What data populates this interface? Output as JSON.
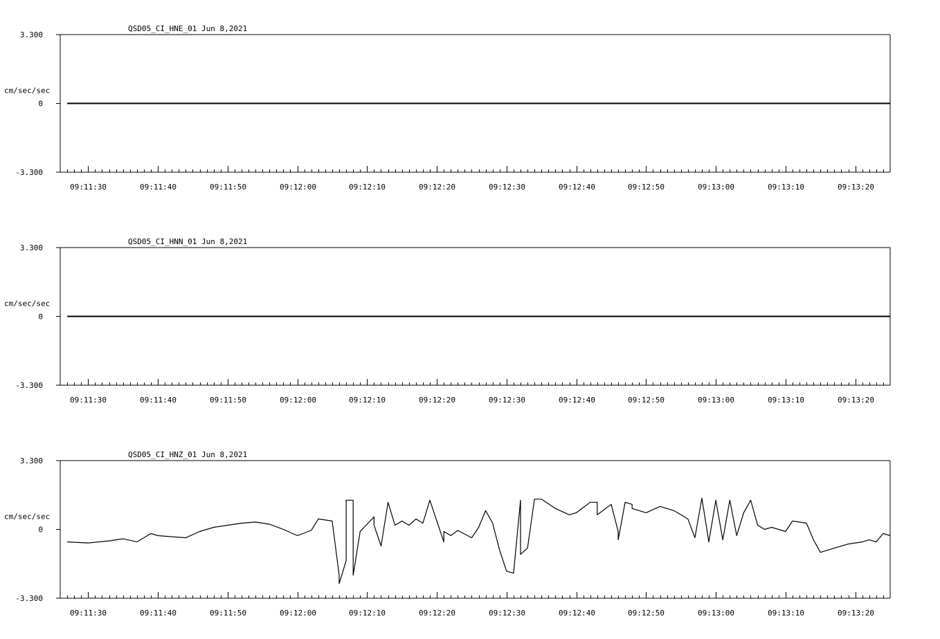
{
  "chart_data": [
    {
      "type": "line",
      "title": "QSD05_CI_HNE_01  Jun 8,2021",
      "ylabel": "cm/sec/sec",
      "ylim": [
        -3.3,
        3.3
      ],
      "y_ticks": [
        "3.300",
        "0",
        "-3.300"
      ],
      "x_start": "09:11:26",
      "x_end": "09:13:25",
      "x_ticks": [
        "09:11:30",
        "09:11:40",
        "09:11:50",
        "09:12:00",
        "09:12:10",
        "09:12:20",
        "09:12:30",
        "09:12:40",
        "09:12:50",
        "09:13:00",
        "09:13:10",
        "09:13:20"
      ],
      "series": [
        {
          "x": [
            "09:11:27",
            "09:13:25"
          ],
          "values": [
            0.0,
            0.0
          ]
        }
      ]
    },
    {
      "type": "line",
      "title": "QSD05_CI_HNN_01  Jun 8,2021",
      "ylabel": "cm/sec/sec",
      "ylim": [
        -3.3,
        3.3
      ],
      "y_ticks": [
        "3.300",
        "0",
        "-3.300"
      ],
      "x_start": "09:11:26",
      "x_end": "09:13:25",
      "x_ticks": [
        "09:11:30",
        "09:11:40",
        "09:11:50",
        "09:12:00",
        "09:12:10",
        "09:12:20",
        "09:12:30",
        "09:12:40",
        "09:12:50",
        "09:13:00",
        "09:13:10",
        "09:13:20"
      ],
      "series": [
        {
          "x": [
            "09:11:27",
            "09:13:25"
          ],
          "values": [
            0.0,
            0.0
          ]
        }
      ]
    },
    {
      "type": "line",
      "title": "QSD05_CI_HNZ_01  Jun 8,2021",
      "ylabel": "cm/sec/sec",
      "ylim": [
        -3.3,
        3.3
      ],
      "y_ticks": [
        "3.300",
        "0",
        "-3.300"
      ],
      "x_start": "09:11:26",
      "x_end": "09:13:25",
      "x_ticks": [
        "09:11:30",
        "09:11:40",
        "09:11:50",
        "09:12:00",
        "09:12:10",
        "09:12:20",
        "09:12:30",
        "09:12:40",
        "09:12:50",
        "09:13:00",
        "09:13:10",
        "09:13:20"
      ],
      "series": [
        {
          "x": [
            "09:11:27",
            "09:11:30",
            "09:11:33",
            "09:11:35",
            "09:11:37",
            "09:11:39",
            "09:11:40",
            "09:11:42",
            "09:11:44",
            "09:11:46",
            "09:11:48",
            "09:11:50",
            "09:11:52",
            "09:11:54",
            "09:11:56",
            "09:11:58",
            "09:12:00",
            "09:12:02",
            "09:12:03",
            "09:12:05",
            "09:12:06",
            "09:12:06",
            "09:12:07",
            "09:12:07",
            "09:12:08",
            "09:12:08",
            "09:12:09",
            "09:12:11",
            "09:12:11",
            "09:12:12",
            "09:12:13",
            "09:12:14",
            "09:12:15",
            "09:12:16",
            "09:12:17",
            "09:12:18",
            "09:12:19",
            "09:12:21",
            "09:12:21",
            "09:12:22",
            "09:12:23",
            "09:12:25",
            "09:12:26",
            "09:12:27",
            "09:12:28",
            "09:12:29",
            "09:12:30",
            "09:12:31",
            "09:12:32",
            "09:12:32",
            "09:12:33",
            "09:12:34",
            "09:12:35",
            "09:12:35",
            "09:12:37",
            "09:12:39",
            "09:12:40",
            "09:12:42",
            "09:12:43",
            "09:12:43",
            "09:12:45",
            "09:12:46",
            "09:12:46",
            "09:12:47",
            "09:12:48",
            "09:12:48",
            "09:12:50",
            "09:12:52",
            "09:12:54",
            "09:12:56",
            "09:12:57",
            "09:12:58",
            "09:12:59",
            "09:13:00",
            "09:13:01",
            "09:13:02",
            "09:13:03",
            "09:13:04",
            "09:13:05",
            "09:13:06",
            "09:13:07",
            "09:13:08",
            "09:13:10",
            "09:13:11",
            "09:13:13",
            "09:13:14",
            "09:13:15",
            "09:13:17",
            "09:13:19",
            "09:13:21",
            "09:13:22",
            "09:13:23",
            "09:13:24",
            "09:13:25"
          ],
          "values": [
            -0.6,
            -0.65,
            -0.55,
            -0.45,
            -0.6,
            -0.2,
            -0.3,
            -0.35,
            -0.4,
            -0.1,
            0.1,
            0.2,
            0.3,
            0.35,
            0.25,
            0.0,
            -0.3,
            -0.05,
            0.5,
            0.4,
            -2.2,
            -2.6,
            -1.5,
            1.4,
            1.4,
            -2.2,
            -0.1,
            0.6,
            0.2,
            -0.8,
            1.3,
            0.2,
            0.4,
            0.2,
            0.5,
            0.3,
            1.4,
            -0.6,
            -0.1,
            -0.3,
            -0.05,
            -0.4,
            0.1,
            0.9,
            0.3,
            -1.0,
            -2.0,
            -2.1,
            1.4,
            -1.2,
            -0.9,
            1.45,
            1.45,
            1.45,
            1.0,
            0.7,
            0.8,
            1.3,
            1.3,
            0.7,
            1.2,
            -0.1,
            -0.5,
            1.3,
            1.2,
            1.0,
            0.8,
            1.1,
            0.9,
            0.5,
            -0.4,
            1.5,
            -0.6,
            1.4,
            -0.5,
            1.4,
            -0.3,
            0.8,
            1.4,
            0.2,
            0.0,
            0.1,
            -0.1,
            0.4,
            0.3,
            -0.5,
            -1.1,
            -0.9,
            -0.7,
            -0.6,
            -0.5,
            -0.6,
            -0.2,
            -0.3
          ]
        }
      ]
    }
  ]
}
